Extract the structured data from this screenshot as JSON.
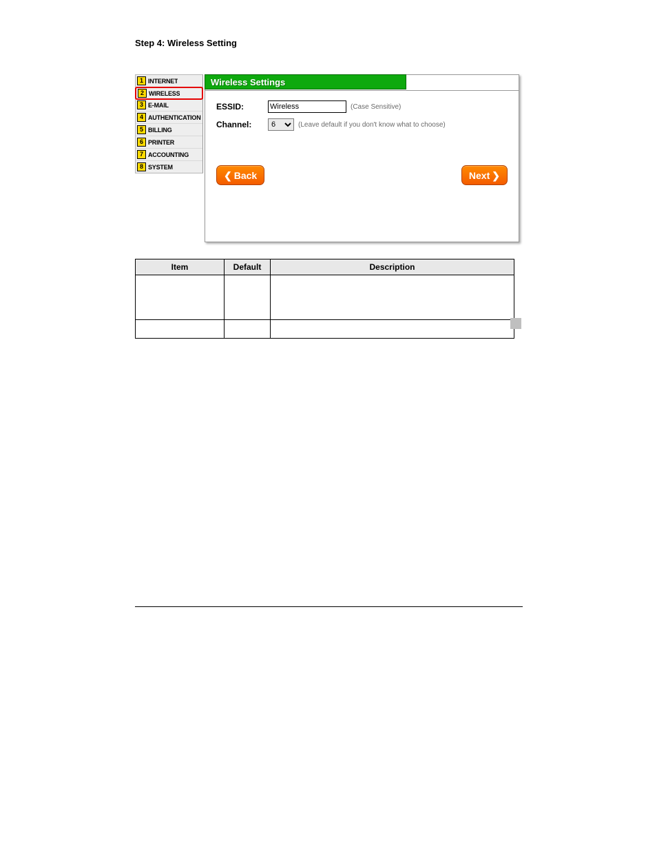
{
  "step_title": "Step 4: Wireless Setting",
  "sidebar": {
    "items": [
      {
        "num": "1",
        "label": "INTERNET"
      },
      {
        "num": "2",
        "label": "WIRELESS"
      },
      {
        "num": "3",
        "label": "E-MAIL"
      },
      {
        "num": "4",
        "label": "AUTHENTICATION"
      },
      {
        "num": "5",
        "label": "BILLING"
      },
      {
        "num": "6",
        "label": "PRINTER"
      },
      {
        "num": "7",
        "label": "ACCOUNTING"
      },
      {
        "num": "8",
        "label": "SYSTEM"
      }
    ],
    "active_index": 1
  },
  "panel": {
    "title": "Wireless Settings",
    "fields": {
      "essid_label": "ESSID:",
      "essid_value": "Wireless",
      "essid_hint": "(Case Sensitive)",
      "channel_label": "Channel:",
      "channel_value": "6",
      "channel_hint": "(Leave default if you don't know what to choose)"
    },
    "buttons": {
      "back": "Back",
      "next": "Next"
    }
  },
  "table": {
    "headers": {
      "item": "Item",
      "default": "Default",
      "description": "Description"
    }
  }
}
